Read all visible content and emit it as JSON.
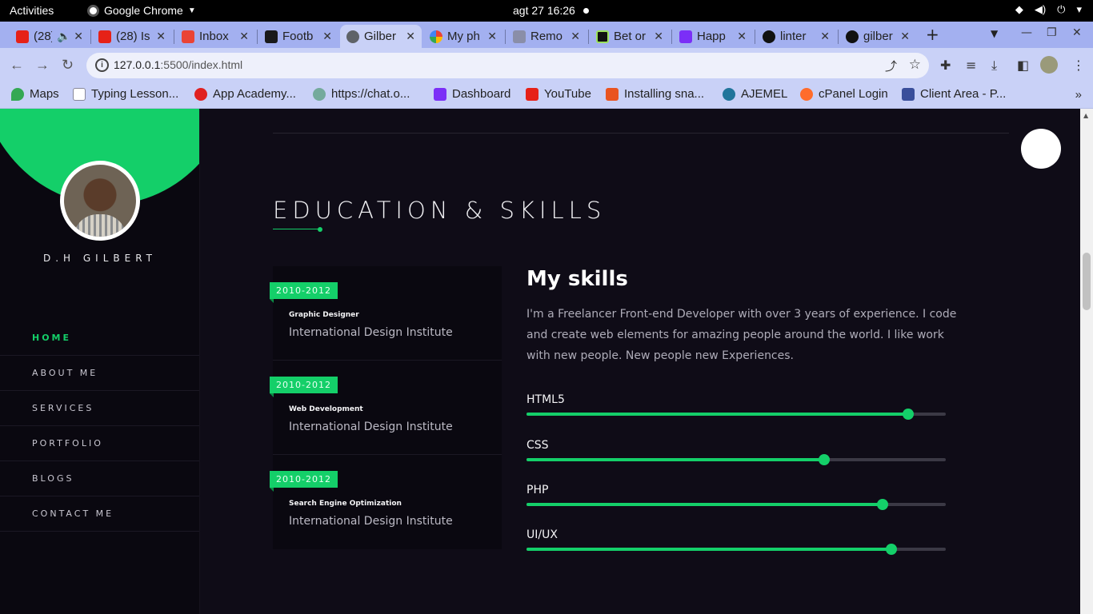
{
  "system": {
    "activities": "Activities",
    "app_name": "Google Chrome",
    "clock": "agt 27  16:26"
  },
  "tabs": [
    {
      "label": "(28)",
      "fav": "#e62117",
      "icon": "youtube-icon"
    },
    {
      "label": "(28) Is",
      "fav": "#e62117",
      "icon": "youtube-icon"
    },
    {
      "label": "Inbox",
      "fav": "#ea4335",
      "icon": "gmail-icon"
    },
    {
      "label": "Footb",
      "fav": "#1a1a1a",
      "icon": "football-icon"
    },
    {
      "label": "Gilber",
      "fav": "#5f6368",
      "icon": "globe-icon"
    },
    {
      "label": "My ph",
      "fav": "#fbbc04",
      "icon": "photos-icon"
    },
    {
      "label": "Remo",
      "fav": "#8a8ea8",
      "icon": "remote-icon"
    },
    {
      "label": "Bet or",
      "fav": "#111111",
      "icon": "bet-icon"
    },
    {
      "label": "Happ",
      "fav": "#7b2ff7",
      "icon": "happy-icon"
    },
    {
      "label": "linter",
      "fav": "#111111",
      "icon": "github-icon"
    },
    {
      "label": "gilber",
      "fav": "#111111",
      "icon": "github-icon"
    }
  ],
  "omnibox": {
    "host": "127.0.0.1",
    "path": ":5500/index.html"
  },
  "bookmarks": [
    {
      "label": "Maps",
      "fav": "#34a853"
    },
    {
      "label": "Typing Lesson...",
      "fav": "#ffffff"
    },
    {
      "label": "App Academy...",
      "fav": "#e02020"
    },
    {
      "label": "https://chat.o...",
      "fav": "#74aa9c"
    },
    {
      "label": "Dashboard",
      "fav": "#7b2ff7"
    },
    {
      "label": "YouTube",
      "fav": "#e62117"
    },
    {
      "label": "Installing sna...",
      "fav": "#e95420"
    },
    {
      "label": "AJEMEL",
      "fav": "#21759b"
    },
    {
      "label": "cPanel Login",
      "fav": "#ff6c2c"
    },
    {
      "label": "Client Area - P...",
      "fav": "#3a4f9b"
    }
  ],
  "profile": {
    "name": "D.H GILBERT"
  },
  "nav": [
    {
      "label": "HOME",
      "active": true
    },
    {
      "label": "ABOUT ME",
      "active": false
    },
    {
      "label": "SERVICES",
      "active": false
    },
    {
      "label": "PORTFOLIO",
      "active": false
    },
    {
      "label": "BLOGS",
      "active": false
    },
    {
      "label": "CONTACT ME",
      "active": false
    }
  ],
  "section": {
    "title": "EDUCATION & SKILLS"
  },
  "education": [
    {
      "years": "2010-2012",
      "role": "Graphic Designer",
      "school": "International Design Institute"
    },
    {
      "years": "2010-2012",
      "role": "Web Development",
      "school": "International Design Institute"
    },
    {
      "years": "2010-2012",
      "role": "Search Engine Optimization",
      "school": "International Design Institute"
    }
  ],
  "skills": {
    "title": "My skills",
    "description": "I'm a Freelancer Front-end Developer with over 3 years of experience. I code and create web elements for amazing people around the world. I like work with new people. New people new Experiences.",
    "items": [
      {
        "label": "HTML5",
        "level": 0.91
      },
      {
        "label": "CSS",
        "level": 0.71
      },
      {
        "label": "PHP",
        "level": 0.85
      },
      {
        "label": "UI/UX",
        "level": 0.87
      }
    ]
  },
  "colors": {
    "accent": "#14cf69",
    "page_bg": "#0f0c17",
    "sidebar_bg": "#0a0810"
  }
}
